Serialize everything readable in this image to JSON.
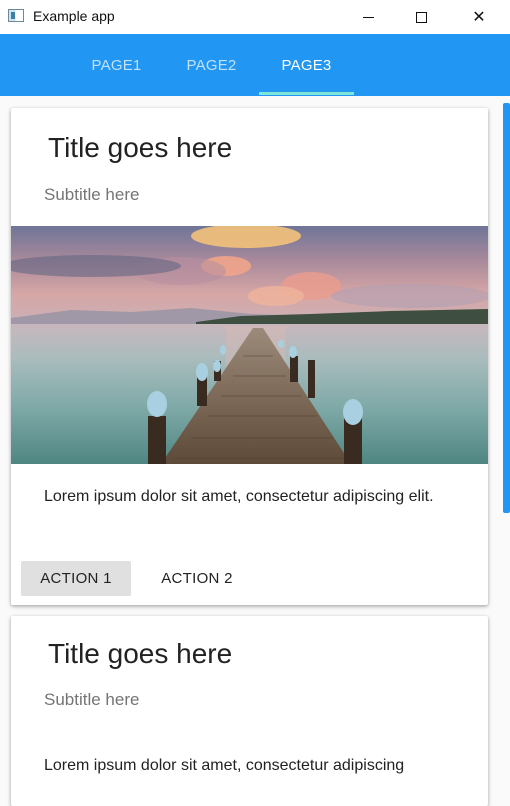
{
  "window": {
    "title": "Example app",
    "controls": {
      "minimize": "—",
      "maximize": "☐",
      "close": "✕"
    }
  },
  "tabs": [
    {
      "label": "PAGE1",
      "active": false
    },
    {
      "label": "PAGE2",
      "active": false
    },
    {
      "label": "PAGE3",
      "active": true
    }
  ],
  "cards": [
    {
      "title": "Title goes here",
      "subtitle": "Subtitle here",
      "body": "Lorem ipsum dolor sit amet, consectetur adipiscing elit.",
      "actions": [
        "ACTION 1",
        "ACTION 2"
      ]
    },
    {
      "title": "Title goes here",
      "subtitle": "Subtitle here",
      "body": "Lorem ipsum dolor sit amet, consectetur adipiscing"
    }
  ],
  "colors": {
    "primary": "#2196f3",
    "tab_indicator": "#7ee6d8",
    "card_background": "#ffffff",
    "page_background": "#fafafa"
  }
}
